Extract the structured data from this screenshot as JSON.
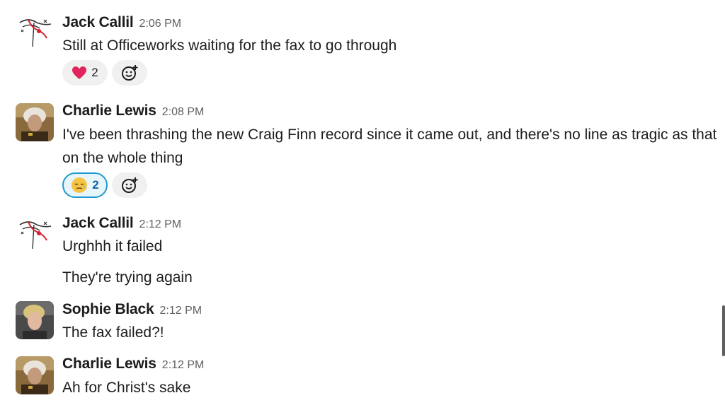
{
  "messages": [
    {
      "author": "Jack Callil",
      "time": "2:06 PM",
      "lines": [
        "Still at Officeworks waiting for the fax to go through"
      ],
      "reaction": {
        "emoji": "heart",
        "count": "2"
      }
    },
    {
      "author": "Charlie Lewis",
      "time": "2:08 PM",
      "lines": [
        "I've been thrashing the new Craig Finn record since it came out, and there's no line as tragic as that on the whole thing"
      ],
      "reaction": {
        "emoji": "face-with-tear",
        "count": "2"
      }
    },
    {
      "author": "Jack Callil",
      "time": "2:12 PM",
      "lines": [
        "Urghhh it failed",
        "They're trying again"
      ]
    },
    {
      "author": "Sophie Black",
      "time": "2:12 PM",
      "lines": [
        "The fax failed?!"
      ]
    },
    {
      "author": "Charlie Lewis",
      "time": "2:12 PM",
      "lines": [
        "Ah for Christ's sake"
      ]
    }
  ],
  "colors": {
    "accent": "#1d9bd1",
    "active_reaction_text": "#1264a3",
    "heart": "#e0245e",
    "timestamp": "#616061"
  },
  "icons": {
    "add_reaction": "add-reaction-icon"
  }
}
